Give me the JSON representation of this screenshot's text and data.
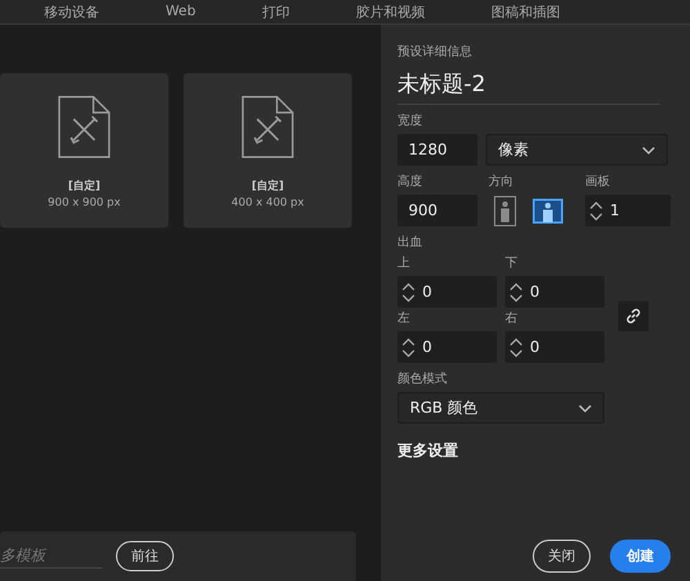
{
  "tabs": [
    {
      "label": "移动设备",
      "selected": false
    },
    {
      "label": "Web",
      "selected": false
    },
    {
      "label": "打印",
      "selected": false
    },
    {
      "label": "胶片和视频",
      "selected": false
    },
    {
      "label": "图稿和插图",
      "selected": false
    }
  ],
  "presets": [
    {
      "name": "[自定]",
      "size": "900 x 900 px"
    },
    {
      "name": "[自定]",
      "size": "400 x 400 px"
    }
  ],
  "template_search": {
    "placeholder": "多模板",
    "button": "前往"
  },
  "details": {
    "heading": "预设详细信息",
    "title": "未标题-2",
    "width": {
      "label": "宽度",
      "value": "1280",
      "unit": "像素"
    },
    "height": {
      "label": "高度",
      "value": "900"
    },
    "orientation": {
      "label": "方向",
      "options": [
        {
          "kind": "portrait",
          "selected": false
        },
        {
          "kind": "landscape",
          "selected": true
        }
      ]
    },
    "artboards": {
      "label": "画板",
      "value": "1"
    },
    "bleed": {
      "label": "出血",
      "fields": [
        {
          "label": "上",
          "value": "0"
        },
        {
          "label": "下",
          "value": "0"
        },
        {
          "label": "左",
          "value": "0"
        },
        {
          "label": "右",
          "value": "0"
        }
      ]
    },
    "color_mode": {
      "label": "颜色模式",
      "value": "RGB 颜色"
    },
    "more_settings": "更多设置"
  },
  "buttons": {
    "close": "关闭",
    "create": "创建"
  }
}
